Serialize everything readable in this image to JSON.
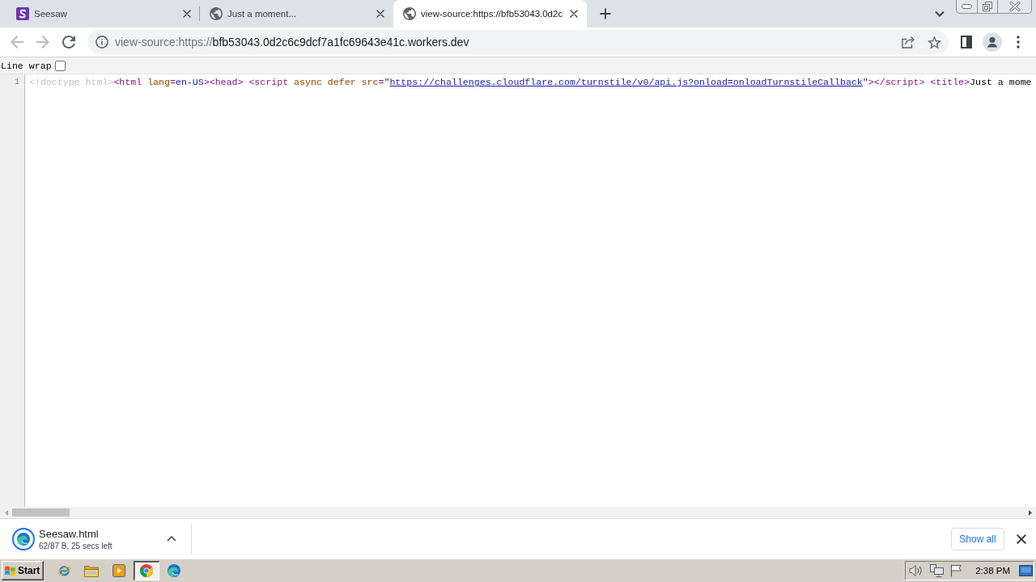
{
  "tabs": [
    {
      "kind": "logo",
      "title": "Seesaw",
      "selected": false
    },
    {
      "kind": "globe",
      "title": "Just a moment...",
      "selected": false
    },
    {
      "kind": "globe",
      "title": "view-source:https://bfb53043.0d2c",
      "selected": true
    }
  ],
  "toolbar": {
    "nav_buttons": [
      {
        "kind": "back",
        "disabled": true
      },
      {
        "kind": "forward",
        "disabled": true
      },
      {
        "kind": "reload",
        "disabled": false
      }
    ],
    "address": {
      "scheme": "view-source:https://",
      "host": "bfb53043.0d2c6c9dcf7a1fc69643e41c.workers.dev"
    }
  },
  "source": {
    "line_wrap": {
      "label": "Line wrap",
      "checked": false
    },
    "lines": [
      {
        "number": "1",
        "tokens": [
          {
            "kind": "doctype",
            "text": "<!doctype html>"
          },
          {
            "kind": "tag",
            "text": "<html "
          },
          {
            "kind": "attr_name",
            "text": "lang"
          },
          {
            "kind": "tag",
            "text": "="
          },
          {
            "kind": "attr_value",
            "text": "en-US"
          },
          {
            "kind": "tag",
            "text": ">"
          },
          {
            "kind": "tag",
            "text": "<head> "
          },
          {
            "kind": "tag",
            "text": "<script "
          },
          {
            "kind": "attr_name",
            "text": "async "
          },
          {
            "kind": "attr_name",
            "text": "defer "
          },
          {
            "kind": "attr_name",
            "text": "src"
          },
          {
            "kind": "tag",
            "text": "="
          },
          {
            "kind": "attr_value",
            "text": "\""
          },
          {
            "kind": "link",
            "text": "https://challenges.cloudflare.com/turnstile/v0/api.js?onload=onloadTurnstileCallback"
          },
          {
            "kind": "attr_value",
            "text": "\""
          },
          {
            "kind": "tag",
            "text": ">"
          },
          {
            "kind": "tag",
            "text": "</script> "
          },
          {
            "kind": "tag",
            "text": "<title>"
          },
          {
            "kind": "text",
            "text": "Just a mome"
          }
        ]
      }
    ]
  },
  "download_bar": {
    "item": {
      "file_name": "Seesaw.html",
      "status": "62/87 B, 25 secs left"
    },
    "show_all": "Show all"
  },
  "taskbar": {
    "start": "Start",
    "apps": [
      {
        "kind": "ie",
        "selected": false
      },
      {
        "kind": "folder",
        "selected": false
      },
      {
        "kind": "media",
        "selected": false
      },
      {
        "kind": "chrome",
        "selected": true
      },
      {
        "kind": "edge",
        "selected": false
      }
    ],
    "clock": "2:38 PM"
  }
}
